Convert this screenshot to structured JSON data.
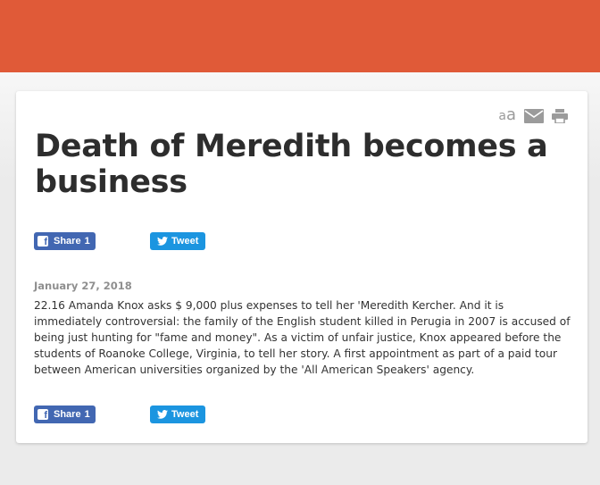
{
  "article": {
    "title": "Death of Meredith becomes a business",
    "date": "January 27, 2018",
    "body": "22.16 Amanda Knox asks $ 9,000 plus expenses to tell her 'Meredith Kercher. And it is immediately controversial: the family of the English student killed in Perugia in 2007 is accused of being just hunting for \"fame and money\". As a victim of unfair justice, Knox appeared before the students of Roanoke College, Virginia, to tell her story. A first appointment as part of a paid tour between American universities organized by the 'All American Speakers' agency."
  },
  "tools": {
    "font_small": "a",
    "font_large": "a",
    "icons": [
      "font-size-icon",
      "mail-icon",
      "print-icon"
    ]
  },
  "share": {
    "facebook_label": "Share",
    "facebook_count": "1",
    "twitter_label": "Tweet"
  },
  "colors": {
    "header": "#e05a38",
    "facebook": "#4267b2",
    "twitter": "#1b95e0",
    "title": "#2d2d2d",
    "date": "#8f8f8f"
  }
}
